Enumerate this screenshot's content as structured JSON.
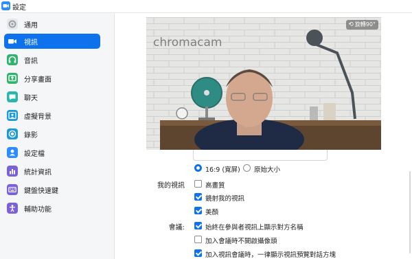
{
  "window": {
    "title": "設定"
  },
  "sidebar": {
    "items": [
      {
        "label": "通用",
        "icon": "gear-icon",
        "color": "#e5e7eb",
        "active": false
      },
      {
        "label": "視訊",
        "icon": "video-camera-icon",
        "color": "#ffffff",
        "active": true
      },
      {
        "label": "音訊",
        "icon": "headphones-icon",
        "color": "#2fb46e",
        "active": false
      },
      {
        "label": "分享畫面",
        "icon": "share-screen-icon",
        "color": "#2fb46e",
        "active": false
      },
      {
        "label": "聊天",
        "icon": "chat-icon",
        "color": "#28b7b0",
        "active": false
      },
      {
        "label": "虛擬背景",
        "icon": "virtual-background-icon",
        "color": "#1a9ad6",
        "active": false
      },
      {
        "label": "錄影",
        "icon": "record-icon",
        "color": "#1a9ad6",
        "active": false
      },
      {
        "label": "設定檔",
        "icon": "profile-icon",
        "color": "#2d8cff",
        "active": false
      },
      {
        "label": "統計資訊",
        "icon": "statistics-icon",
        "color": "#7b61d9",
        "active": false
      },
      {
        "label": "鍵盤快速鍵",
        "icon": "keyboard-icon",
        "color": "#7b61d9",
        "active": false
      },
      {
        "label": "輔助功能",
        "icon": "accessibility-icon",
        "color": "#7b61d9",
        "active": false
      }
    ]
  },
  "preview": {
    "watermark": "chromacam",
    "rotate_label": "旋轉90°"
  },
  "ratio": {
    "options": [
      {
        "label": "16:9 (寬屏)",
        "selected": true
      },
      {
        "label": "原始大小",
        "selected": false
      }
    ]
  },
  "my_video": {
    "label": "我的視訊",
    "options": [
      {
        "label": "高畫質",
        "checked": false
      },
      {
        "label": "鏡射我的視訊",
        "checked": true
      },
      {
        "label": "美顏",
        "checked": true
      }
    ]
  },
  "meeting": {
    "label": "會議:",
    "options": [
      {
        "label": "始終在參與者視訊上顯示對方名稱",
        "checked": true
      },
      {
        "label": "加入會議時不開啟攝像頭",
        "checked": false
      },
      {
        "label": "加入視訊會議時，一律顯示視訊預覽對話方塊",
        "checked": true
      }
    ]
  },
  "colors": {
    "accent": "#0e72ed"
  }
}
